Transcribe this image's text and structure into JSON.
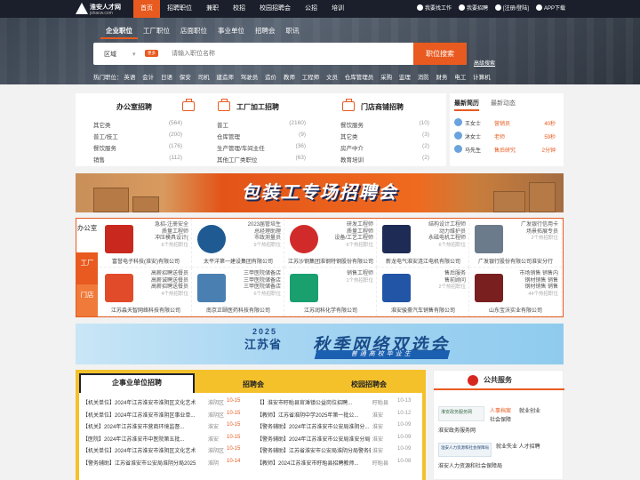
{
  "logo": {
    "name": "淮安人才网",
    "domain": "jshacw.com"
  },
  "nav": [
    "首页",
    "招聘职位",
    "兼职",
    "校招",
    "校园招聘会",
    "公招",
    "培训"
  ],
  "top_right": [
    "我要找工作",
    "我要招聘",
    "[注册/登陆]",
    "APP下载"
  ],
  "search": {
    "tabs": [
      "企业职位",
      "工厂职位",
      "店面职位",
      "事业单位",
      "招聘会",
      "职讯"
    ],
    "region": "区域",
    "region_badge": "更多",
    "placeholder": "请输入职位名称",
    "button": "职位搜索",
    "advanced": "高级搜索",
    "hot_label": "热门职位：",
    "hot": [
      "英语",
      "会计",
      "日语",
      "保安",
      "司机",
      "建造师",
      "驾驶员",
      "造价",
      "教师",
      "工程师",
      "文员",
      "仓库管理员",
      "采购",
      "监理",
      "消防",
      "财务",
      "电工",
      "计算机"
    ]
  },
  "categories": [
    {
      "title": "办公室招聘",
      "rows": [
        {
          "name": "其它类",
          "count": "(564)"
        },
        {
          "name": "普工/技工",
          "count": "(200)"
        },
        {
          "name": "餐饮服务",
          "count": "(176)"
        },
        {
          "name": "销售",
          "count": "(112)"
        }
      ]
    },
    {
      "title": "工厂加工招聘",
      "rows": [
        {
          "name": "普工",
          "count": "(2160)"
        },
        {
          "name": "仓库管理",
          "count": "(9)"
        },
        {
          "name": "生产管理/车间主任",
          "count": "(36)"
        },
        {
          "name": "其他工厂类职位",
          "count": "(63)"
        }
      ]
    },
    {
      "title": "门店商铺招聘",
      "rows": [
        {
          "name": "餐饮服务",
          "count": "(10)"
        },
        {
          "name": "其它类",
          "count": "(3)"
        },
        {
          "name": "房产中介",
          "count": "(2)"
        },
        {
          "name": "教育培训",
          "count": "(2)"
        }
      ]
    }
  ],
  "news": {
    "tabs": [
      "最新简历",
      "最新动态"
    ],
    "items": [
      {
        "name": "王女士",
        "job": "营销员",
        "time": "40秒"
      },
      {
        "name": "沐女士",
        "job": "老师",
        "time": "59秒"
      },
      {
        "name": "马先生",
        "job": "售后研究",
        "time": "2分钟"
      }
    ]
  },
  "banner1": {
    "title": "包装工专场招聘会"
  },
  "job_side": [
    "办公室",
    "工厂",
    "门店"
  ],
  "companies": [
    {
      "name": "富誉电子科技(淮安)有限公司",
      "jobs": [
        "急招-注册安全",
        "质量工程师",
        "冲压模具设计("
      ],
      "hint": "6个热招职位"
    },
    {
      "name": "太平洋第一建设集团有限公司",
      "jobs": [
        "2023届管培生",
        "总经理助理",
        "市政测量员"
      ],
      "hint": "9个热招职位"
    },
    {
      "name": "江苏沙钢集团淮钢特钢股份有限公司",
      "jobs": [
        "研发工程师",
        "质量工程师",
        "设备/工艺工程师"
      ],
      "hint": "6个热招职位"
    },
    {
      "name": "新龙电气淮安涟江电机有限公司",
      "jobs": [
        "结构设计工程师",
        "动力维护员",
        "永磁电机工程师"
      ],
      "hint": "6个热招职位"
    },
    {
      "name": "广发银行股份有限公司淮安分行",
      "jobs": [
        "广发银行信用卡",
        "场景拓展专员"
      ],
      "hint": "2个热招职位"
    },
    {
      "name": "江苏淼天智网络科技有限公司",
      "jobs": [
        "高薪招聘送餐员",
        "高薪诚聘送餐员",
        "高薪招聘送餐员"
      ],
      "hint": "4个热招职位"
    },
    {
      "name": "南京正颐医药科技有限公司",
      "jobs": [
        "三甲医院储备店",
        "三甲医院储备店",
        "三甲医院储备店"
      ],
      "hint": "6个热招职位"
    },
    {
      "name": "江苏润科化学有限公司",
      "jobs": [
        "销售工程师"
      ],
      "hint": "1个热招职位"
    },
    {
      "name": "淮安骏豪汽车销售有限公司",
      "jobs": [
        "售后服务",
        "售前顾问"
      ],
      "hint": "2个热招职位"
    },
    {
      "name": "山东宝沃实业有限公司",
      "jobs": [
        "市场销售 销售内",
        "钢材销售 销售",
        "钢材销售 销售"
      ],
      "hint": "44个热招职位"
    }
  ],
  "banner2": {
    "year": "2025",
    "province": "江苏省",
    "main": "秋季网络双选会",
    "sub": "普通高校毕业生"
  },
  "lower_tabs": [
    "企事业单位招聘",
    "招聘会",
    "校园招聘会"
  ],
  "lower_left": [
    {
      "title": "【机关单位】2024年江苏淮安市淮阴区文化艺术...",
      "loc": "淮阴区",
      "date": "10-15"
    },
    {
      "title": "【机关单位】2024年江苏淮安市淮阴区事业单...",
      "loc": "淮阴区",
      "date": "10-15"
    },
    {
      "title": "【机关】2024年江苏淮安市营商环境监督...",
      "loc": "淮安",
      "date": "10-15"
    },
    {
      "title": "【医院】2024年江苏淮安市中医院第五批...",
      "loc": "淮安",
      "date": "10-15"
    },
    {
      "title": "【机关单位】2024年江苏淮安市淮阴区文化艺术...",
      "loc": "淮阴区",
      "date": "10-15"
    },
    {
      "title": "【警务辅助】江苏省淮安市公安局淮阴分局2025...",
      "loc": "淮阴",
      "date": "10-14"
    }
  ],
  "lower_right": [
    {
      "title": "【】淮安市盱眙县官滩镇公益岗位招聘...",
      "loc": "盱眙县",
      "date": "10-13"
    },
    {
      "title": "【教师】江苏省淮阴中学2025年第一批公...",
      "loc": "淮安",
      "date": "10-12"
    },
    {
      "title": "【警务辅助】2024年江苏淮安市公安局淮阴分...",
      "loc": "淮安",
      "date": "10-09"
    },
    {
      "title": "【警务辅助】2024年江苏淮安市公安局淮安分局警...",
      "loc": "淮安",
      "date": "10-09"
    },
    {
      "title": "【警务辅助】江苏省淮安市公安局淮阴分局警务辅...",
      "loc": "淮安",
      "date": "10-09"
    },
    {
      "title": "【教师】2024江苏淮安市盱眙县招聘教师...",
      "loc": "盱眙县",
      "date": "10-08"
    }
  ],
  "public": {
    "title": "公共服务",
    "card1": "淮安政务服务网",
    "l1": "人事档案",
    "l2": "就业创业",
    "l3": "社会保障",
    "l4": "淮安政务服务网",
    "card2": "淮安人力资源和社会保障局",
    "l5": "就业失业 人才招聘",
    "l6": "淮安人力资源和社会保障局"
  },
  "colors": {
    "accent": "#e85a1f",
    "topbar": "#1a1f2b",
    "lower_bg": "#f5c12b"
  }
}
